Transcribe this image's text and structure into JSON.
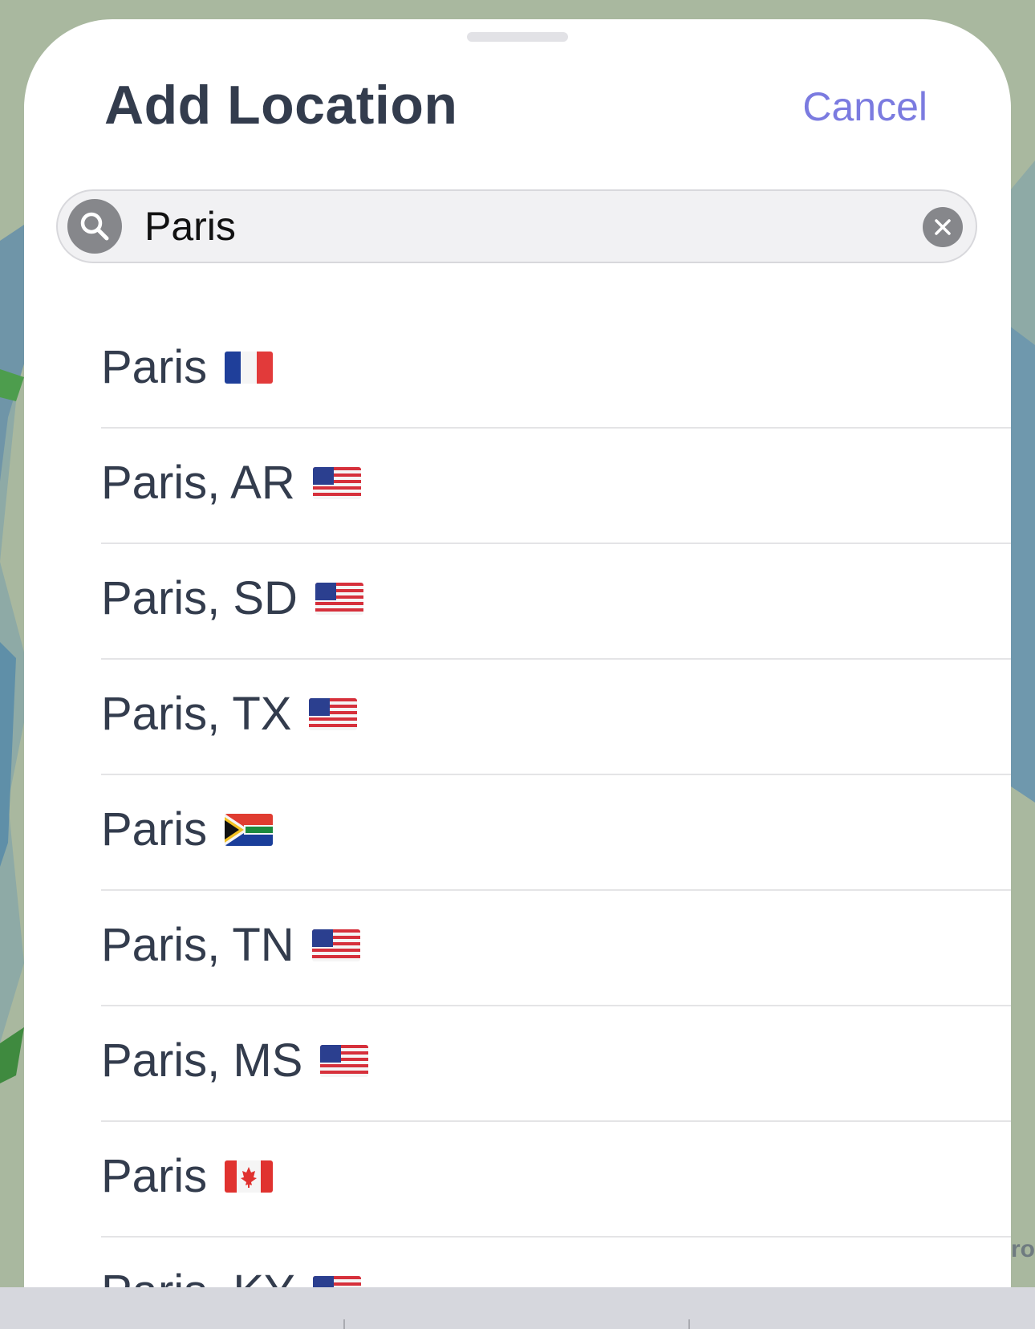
{
  "sheet": {
    "title": "Add Location",
    "cancel_label": "Cancel"
  },
  "search": {
    "value": "Paris",
    "icon": "magnifying-glass-icon",
    "clear_icon": "clear-x-icon"
  },
  "results": [
    {
      "label": "Paris",
      "flag": "france"
    },
    {
      "label": "Paris, AR",
      "flag": "usa"
    },
    {
      "label": "Paris, SD",
      "flag": "usa"
    },
    {
      "label": "Paris, TX",
      "flag": "usa"
    },
    {
      "label": "Paris",
      "flag": "south-africa"
    },
    {
      "label": "Paris, TN",
      "flag": "usa"
    },
    {
      "label": "Paris, MS",
      "flag": "usa"
    },
    {
      "label": "Paris",
      "flag": "canada"
    },
    {
      "label": "Paris, KY",
      "flag": "usa"
    }
  ],
  "map": {
    "edge_label": "ro"
  },
  "colors": {
    "accent": "#7b7be0",
    "title_text": "#333c4d",
    "divider": "#e4e4e6"
  }
}
